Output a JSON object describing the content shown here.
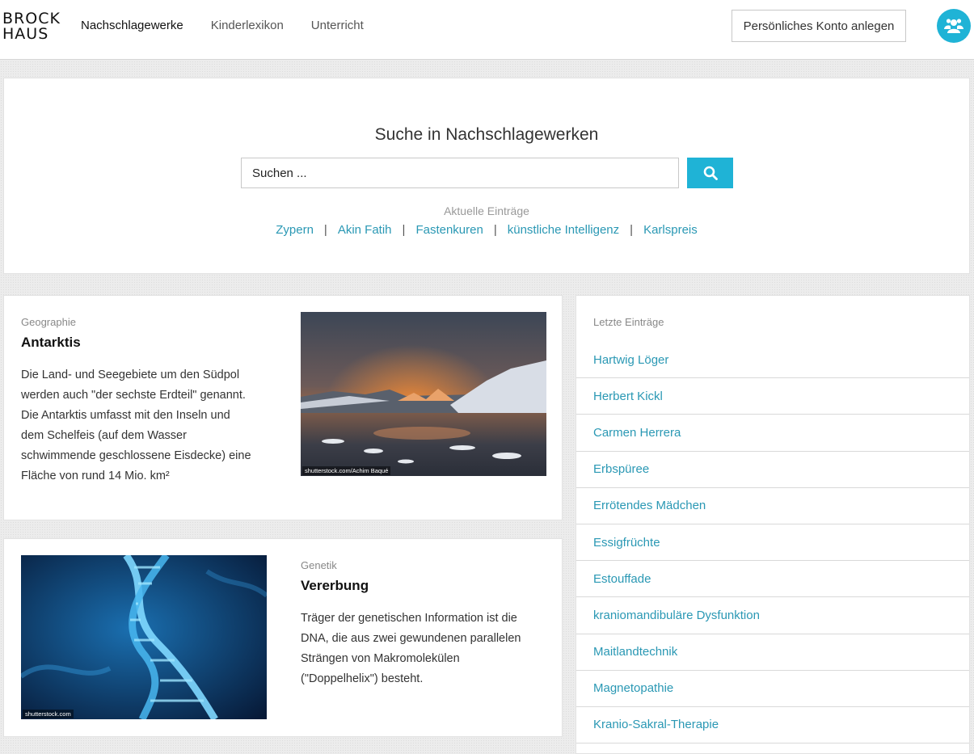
{
  "header": {
    "logo_line1": "BROCK",
    "logo_line2": "HAUS",
    "nav": [
      {
        "label": "Nachschlagewerke",
        "active": true
      },
      {
        "label": "Kinderlexikon",
        "active": false
      },
      {
        "label": "Unterricht",
        "active": false
      }
    ],
    "account_button": "Persönliches Konto anlegen",
    "avatar_icon": "users-icon"
  },
  "search": {
    "title": "Suche in Nachschlagewerken",
    "placeholder": "Suchen ...",
    "button_icon": "search-icon",
    "recent_label": "Aktuelle Einträge",
    "recent_links": [
      "Zypern",
      "Akin Fatih",
      "Fastenkuren",
      "künstliche Intelligenz",
      "Karlspreis"
    ],
    "separator": "|"
  },
  "articles": [
    {
      "category": "Geographie",
      "title": "Antarktis",
      "text_lines": [
        "Die Land- und Seegebiete um den Südpol",
        "werden auch \"der sechste Erdteil\" genannt.",
        "Die Antarktis umfasst mit den Inseln und",
        "dem Schelfeis (auf dem Wasser",
        "schwimmende geschlossene Eisdecke) eine",
        "Fläche von rund 14 Mio. km²"
      ],
      "image_credit": "shutterstock.com/Achim Baqué"
    },
    {
      "category": "Genetik",
      "title": "Vererbung",
      "text_lines": [
        "Träger der genetischen Information ist die",
        "DNA, die aus zwei gewundenen parallelen",
        "Strängen von Makromolekülen",
        "(\"Doppelhelix\") besteht."
      ],
      "image_credit": "shutterstock.com"
    }
  ],
  "sidebar": {
    "label": "Letzte Einträge",
    "items": [
      "Hartwig Löger",
      "Herbert Kickl",
      "Carmen Herrera",
      "Erbspüree",
      "Errötendes Mädchen",
      "Essigfrüchte",
      "Estouffade",
      "kraniomandibuläre Dysfunktion",
      "Maitlandtechnik",
      "Magnetopathie",
      "Kranio-Sakral-Therapie"
    ]
  },
  "colors": {
    "accent": "#1fb3d6",
    "link": "#2a98b4"
  }
}
